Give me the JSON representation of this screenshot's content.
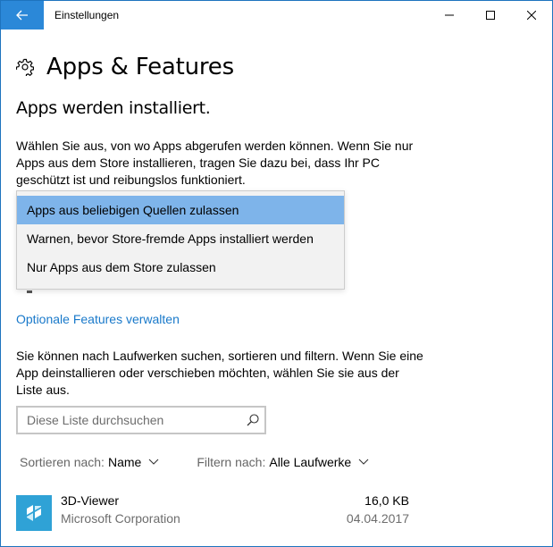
{
  "window": {
    "title": "Einstellungen"
  },
  "page": {
    "title": "Apps & Features"
  },
  "install_section": {
    "heading": "Apps werden installiert.",
    "description": "Wählen Sie aus, von wo Apps abgerufen werden können. Wenn Sie nur Apps aus dem Store installieren, tragen Sie dazu bei, dass Ihr PC geschützt ist und reibungslos funktioniert.",
    "options": [
      {
        "label": "Apps aus beliebigen Quellen zulassen",
        "selected": true
      },
      {
        "label": "Warnen, bevor Store-fremde Apps installiert werden",
        "selected": false
      },
      {
        "label": "Nur Apps aus dem Store zulassen",
        "selected": false
      }
    ]
  },
  "optional_features_link": "Optionale Features verwalten",
  "list_section": {
    "description": "Sie können nach Laufwerken suchen, sortieren und filtern. Wenn Sie eine App deinstallieren oder verschieben möchten, wählen Sie sie aus der Liste aus.",
    "search": {
      "placeholder": "Diese Liste durchsuchen",
      "value": ""
    },
    "sort": {
      "label": "Sortieren nach:",
      "value": "Name"
    },
    "filter": {
      "label": "Filtern nach:",
      "value": "Alle Laufwerke"
    },
    "apps": [
      {
        "name": "3D-Viewer",
        "publisher": "Microsoft Corporation",
        "size": "16,0 KB",
        "date": "04.04.2017",
        "icon": "3d-viewer-icon"
      }
    ]
  },
  "colors": {
    "accent": "#2b88d8",
    "link": "#1979ca",
    "selected_option": "#7eb4ea",
    "app_tile": "#2fa2d6"
  }
}
